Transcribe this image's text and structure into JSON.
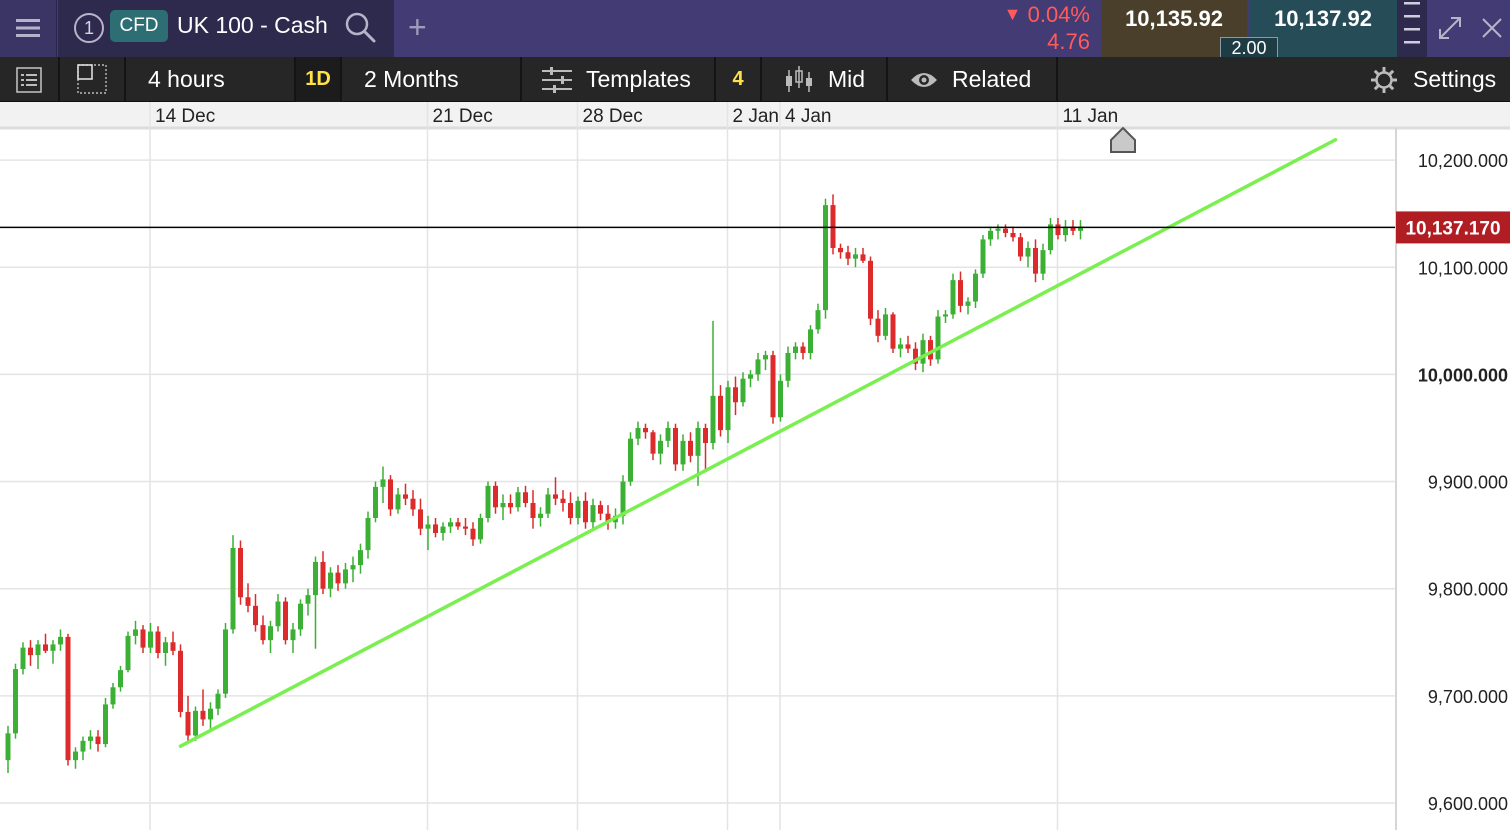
{
  "header": {
    "instrument_number": "1",
    "instrument_type": "CFD",
    "instrument_name": "UK 100 - Cash",
    "add_tab_label": "+",
    "change_percent": "0.04%",
    "change_absolute": "4.76",
    "sell_price": "10,135.92",
    "buy_price": "10,137.92",
    "spread": "2.00",
    "colors": {
      "header_bg": "#433b73",
      "down": "#ff5b5b",
      "sell_bg": "#4a3f2b",
      "buy_bg": "#264c58"
    }
  },
  "toolbar": {
    "interval": "4 hours",
    "quick_period": "1D",
    "period": "2 Months",
    "templates_label": "Templates",
    "templates_count": "4",
    "price_type": "Mid",
    "related_label": "Related",
    "settings_label": "Settings"
  },
  "chart_data": {
    "type": "candlestick",
    "x_tick_labels": [
      "14 Dec",
      "21 Dec",
      "28 Dec",
      "2 Jan",
      "4 Jan",
      "11 Jan"
    ],
    "x_tick_index": [
      19,
      56,
      76,
      96,
      103,
      140
    ],
    "y_ticks": [
      9600,
      9700,
      9800,
      9900,
      10000,
      10100,
      10200
    ],
    "y_tick_labels": [
      "9,600.000",
      "9,700.000",
      "9,800.000",
      "9,900.000",
      "10,000.000",
      "10,100.000",
      "10,200.000"
    ],
    "ylim": [
      9575,
      10240
    ],
    "current_price": 10137.17,
    "current_price_label": "10,137.170",
    "grid": true,
    "colors": {
      "up": "#3cb035",
      "down": "#dd2a2a",
      "trendline": "#7aef50",
      "price_line": "#000000",
      "price_label_bg": "#b01e23"
    },
    "trendline": {
      "from": [
        23,
        9653
      ],
      "to": [
        177,
        10219
      ]
    },
    "candles": [
      [
        0,
        9640,
        9672,
        9628,
        9665
      ],
      [
        1,
        9665,
        9730,
        9660,
        9725
      ],
      [
        2,
        9725,
        9750,
        9720,
        9745
      ],
      [
        3,
        9745,
        9752,
        9728,
        9738
      ],
      [
        4,
        9738,
        9752,
        9725,
        9748
      ],
      [
        5,
        9748,
        9758,
        9740,
        9742
      ],
      [
        6,
        9742,
        9752,
        9730,
        9748
      ],
      [
        7,
        9748,
        9762,
        9742,
        9755
      ],
      [
        8,
        9755,
        9758,
        9635,
        9640
      ],
      [
        9,
        9640,
        9652,
        9632,
        9648
      ],
      [
        10,
        9648,
        9662,
        9640,
        9658
      ],
      [
        11,
        9658,
        9668,
        9650,
        9662
      ],
      [
        12,
        9662,
        9668,
        9648,
        9655
      ],
      [
        13,
        9655,
        9698,
        9652,
        9692
      ],
      [
        14,
        9692,
        9712,
        9688,
        9708
      ],
      [
        15,
        9708,
        9728,
        9704,
        9724
      ],
      [
        16,
        9724,
        9760,
        9722,
        9756
      ],
      [
        17,
        9756,
        9770,
        9748,
        9762
      ],
      [
        18,
        9762,
        9766,
        9740,
        9745
      ],
      [
        19,
        9745,
        9768,
        9740,
        9760
      ],
      [
        20,
        9760,
        9765,
        9735,
        9740
      ],
      [
        21,
        9740,
        9755,
        9728,
        9750
      ],
      [
        22,
        9750,
        9760,
        9738,
        9742
      ],
      [
        23,
        9742,
        9748,
        9680,
        9685
      ],
      [
        24,
        9685,
        9700,
        9656,
        9663
      ],
      [
        25,
        9663,
        9690,
        9658,
        9686
      ],
      [
        26,
        9686,
        9706,
        9672,
        9678
      ],
      [
        27,
        9678,
        9694,
        9666,
        9688
      ],
      [
        28,
        9688,
        9706,
        9682,
        9702
      ],
      [
        29,
        9702,
        9768,
        9698,
        9762
      ],
      [
        30,
        9762,
        9850,
        9758,
        9838
      ],
      [
        31,
        9838,
        9845,
        9785,
        9792
      ],
      [
        32,
        9792,
        9805,
        9778,
        9784
      ],
      [
        33,
        9784,
        9795,
        9760,
        9766
      ],
      [
        34,
        9766,
        9775,
        9748,
        9752
      ],
      [
        35,
        9752,
        9770,
        9740,
        9765
      ],
      [
        36,
        9765,
        9795,
        9760,
        9788
      ],
      [
        37,
        9788,
        9792,
        9748,
        9752
      ],
      [
        38,
        9752,
        9768,
        9740,
        9762
      ],
      [
        39,
        9762,
        9790,
        9756,
        9786
      ],
      [
        40,
        9786,
        9800,
        9775,
        9794
      ],
      [
        41,
        9794,
        9830,
        9744,
        9825
      ],
      [
        42,
        9825,
        9835,
        9795,
        9800
      ],
      [
        43,
        9800,
        9820,
        9792,
        9815
      ],
      [
        44,
        9815,
        9822,
        9798,
        9805
      ],
      [
        45,
        9805,
        9824,
        9800,
        9818
      ],
      [
        46,
        9818,
        9830,
        9806,
        9822
      ],
      [
        47,
        9822,
        9842,
        9814,
        9836
      ],
      [
        48,
        9836,
        9872,
        9828,
        9866
      ],
      [
        49,
        9866,
        9900,
        9862,
        9895
      ],
      [
        50,
        9895,
        9914,
        9880,
        9902
      ],
      [
        51,
        9902,
        9906,
        9868,
        9874
      ],
      [
        52,
        9874,
        9894,
        9870,
        9888
      ],
      [
        53,
        9888,
        9898,
        9878,
        9884
      ],
      [
        54,
        9884,
        9892,
        9868,
        9874
      ],
      [
        55,
        9874,
        9884,
        9850,
        9856
      ],
      [
        56,
        9856,
        9868,
        9836,
        9860
      ],
      [
        57,
        9860,
        9866,
        9848,
        9852
      ],
      [
        58,
        9852,
        9862,
        9845,
        9858
      ],
      [
        59,
        9858,
        9866,
        9852,
        9862
      ],
      [
        60,
        9862,
        9866,
        9855,
        9858
      ],
      [
        61,
        9858,
        9866,
        9850,
        9856
      ],
      [
        62,
        9856,
        9862,
        9840,
        9846
      ],
      [
        63,
        9846,
        9870,
        9842,
        9866
      ],
      [
        64,
        9866,
        9900,
        9862,
        9896
      ],
      [
        65,
        9896,
        9900,
        9870,
        9876
      ],
      [
        66,
        9876,
        9888,
        9864,
        9880
      ],
      [
        67,
        9880,
        9888,
        9870,
        9876
      ],
      [
        68,
        9876,
        9895,
        9872,
        9890
      ],
      [
        69,
        9890,
        9896,
        9876,
        9880
      ],
      [
        70,
        9880,
        9892,
        9856,
        9866
      ],
      [
        71,
        9866,
        9876,
        9858,
        9870
      ],
      [
        72,
        9870,
        9894,
        9866,
        9888
      ],
      [
        73,
        9888,
        9904,
        9878,
        9884
      ],
      [
        74,
        9884,
        9892,
        9872,
        9880
      ],
      [
        75,
        9880,
        9890,
        9860,
        9866
      ],
      [
        76,
        9866,
        9886,
        9860,
        9882
      ],
      [
        77,
        9882,
        9890,
        9856,
        9862
      ],
      [
        78,
        9862,
        9884,
        9856,
        9878
      ],
      [
        79,
        9878,
        9882,
        9864,
        9870
      ],
      [
        80,
        9870,
        9878,
        9855,
        9862
      ],
      [
        81,
        9862,
        9875,
        9856,
        9868
      ],
      [
        82,
        9868,
        9906,
        9860,
        9900
      ],
      [
        83,
        9900,
        9946,
        9896,
        9940
      ],
      [
        84,
        9940,
        9956,
        9934,
        9950
      ],
      [
        85,
        9950,
        9954,
        9940,
        9946
      ],
      [
        86,
        9946,
        9948,
        9920,
        9926
      ],
      [
        87,
        9926,
        9944,
        9916,
        9938
      ],
      [
        88,
        9938,
        9956,
        9932,
        9950
      ],
      [
        89,
        9950,
        9954,
        9910,
        9916
      ],
      [
        90,
        9916,
        9944,
        9910,
        9938
      ],
      [
        91,
        9938,
        9946,
        9918,
        9924
      ],
      [
        92,
        9924,
        9956,
        9896,
        9950
      ],
      [
        93,
        9950,
        9954,
        9910,
        9936
      ],
      [
        94,
        9936,
        10050,
        9930,
        9980
      ],
      [
        95,
        9980,
        9990,
        9942,
        9948
      ],
      [
        96,
        9948,
        9994,
        9936,
        9988
      ],
      [
        97,
        9988,
        9998,
        9962,
        9974
      ],
      [
        98,
        9974,
        10002,
        9970,
        9996
      ],
      [
        99,
        9996,
        10004,
        9988,
        10000
      ],
      [
        100,
        10000,
        10020,
        9994,
        10014
      ],
      [
        101,
        10014,
        10022,
        10004,
        10018
      ],
      [
        102,
        10018,
        10022,
        9954,
        9960
      ],
      [
        103,
        9960,
        10000,
        9956,
        9994
      ],
      [
        104,
        9994,
        10026,
        9988,
        10020
      ],
      [
        105,
        10020,
        10030,
        10014,
        10026
      ],
      [
        106,
        10026,
        10030,
        10014,
        10020
      ],
      [
        107,
        10020,
        10046,
        10014,
        10042
      ],
      [
        108,
        10042,
        10066,
        10038,
        10060
      ],
      [
        109,
        10060,
        10164,
        10052,
        10158
      ],
      [
        110,
        10158,
        10168,
        10112,
        10118
      ],
      [
        111,
        10118,
        10122,
        10108,
        10114
      ],
      [
        112,
        10114,
        10120,
        10102,
        10108
      ],
      [
        113,
        10108,
        10118,
        10100,
        10112
      ],
      [
        114,
        10112,
        10118,
        10104,
        10106
      ],
      [
        115,
        10106,
        10110,
        10046,
        10052
      ],
      [
        116,
        10052,
        10060,
        10030,
        10036
      ],
      [
        117,
        10036,
        10062,
        10032,
        10056
      ],
      [
        118,
        10056,
        10058,
        10020,
        10024
      ],
      [
        119,
        10024,
        10034,
        10016,
        10028
      ],
      [
        120,
        10028,
        10036,
        10020,
        10024
      ],
      [
        121,
        10024,
        10030,
        10004,
        10010
      ],
      [
        122,
        10010,
        10038,
        10002,
        10032
      ],
      [
        123,
        10032,
        10036,
        10008,
        10014
      ],
      [
        124,
        10014,
        10060,
        10010,
        10054
      ],
      [
        125,
        10054,
        10060,
        10048,
        10056
      ],
      [
        126,
        10056,
        10094,
        10052,
        10088
      ],
      [
        127,
        10088,
        10096,
        10058,
        10064
      ],
      [
        128,
        10064,
        10072,
        10056,
        10068
      ],
      [
        129,
        10068,
        10098,
        10062,
        10094
      ],
      [
        130,
        10094,
        10130,
        10090,
        10126
      ],
      [
        131,
        10126,
        10138,
        10120,
        10134
      ],
      [
        132,
        10134,
        10140,
        10126,
        10136
      ],
      [
        133,
        10136,
        10140,
        10128,
        10132
      ],
      [
        134,
        10132,
        10138,
        10124,
        10128
      ],
      [
        135,
        10128,
        10132,
        10106,
        10110
      ],
      [
        136,
        10110,
        10124,
        10100,
        10118
      ],
      [
        137,
        10118,
        10126,
        10086,
        10094
      ],
      [
        138,
        10094,
        10122,
        10088,
        10116
      ],
      [
        139,
        10116,
        10146,
        10112,
        10140
      ],
      [
        140,
        10140,
        10146,
        10126,
        10130
      ],
      [
        141,
        10130,
        10144,
        10124,
        10138
      ],
      [
        142,
        10138,
        10144,
        10130,
        10134
      ],
      [
        143,
        10134,
        10144,
        10126,
        10138
      ]
    ]
  }
}
